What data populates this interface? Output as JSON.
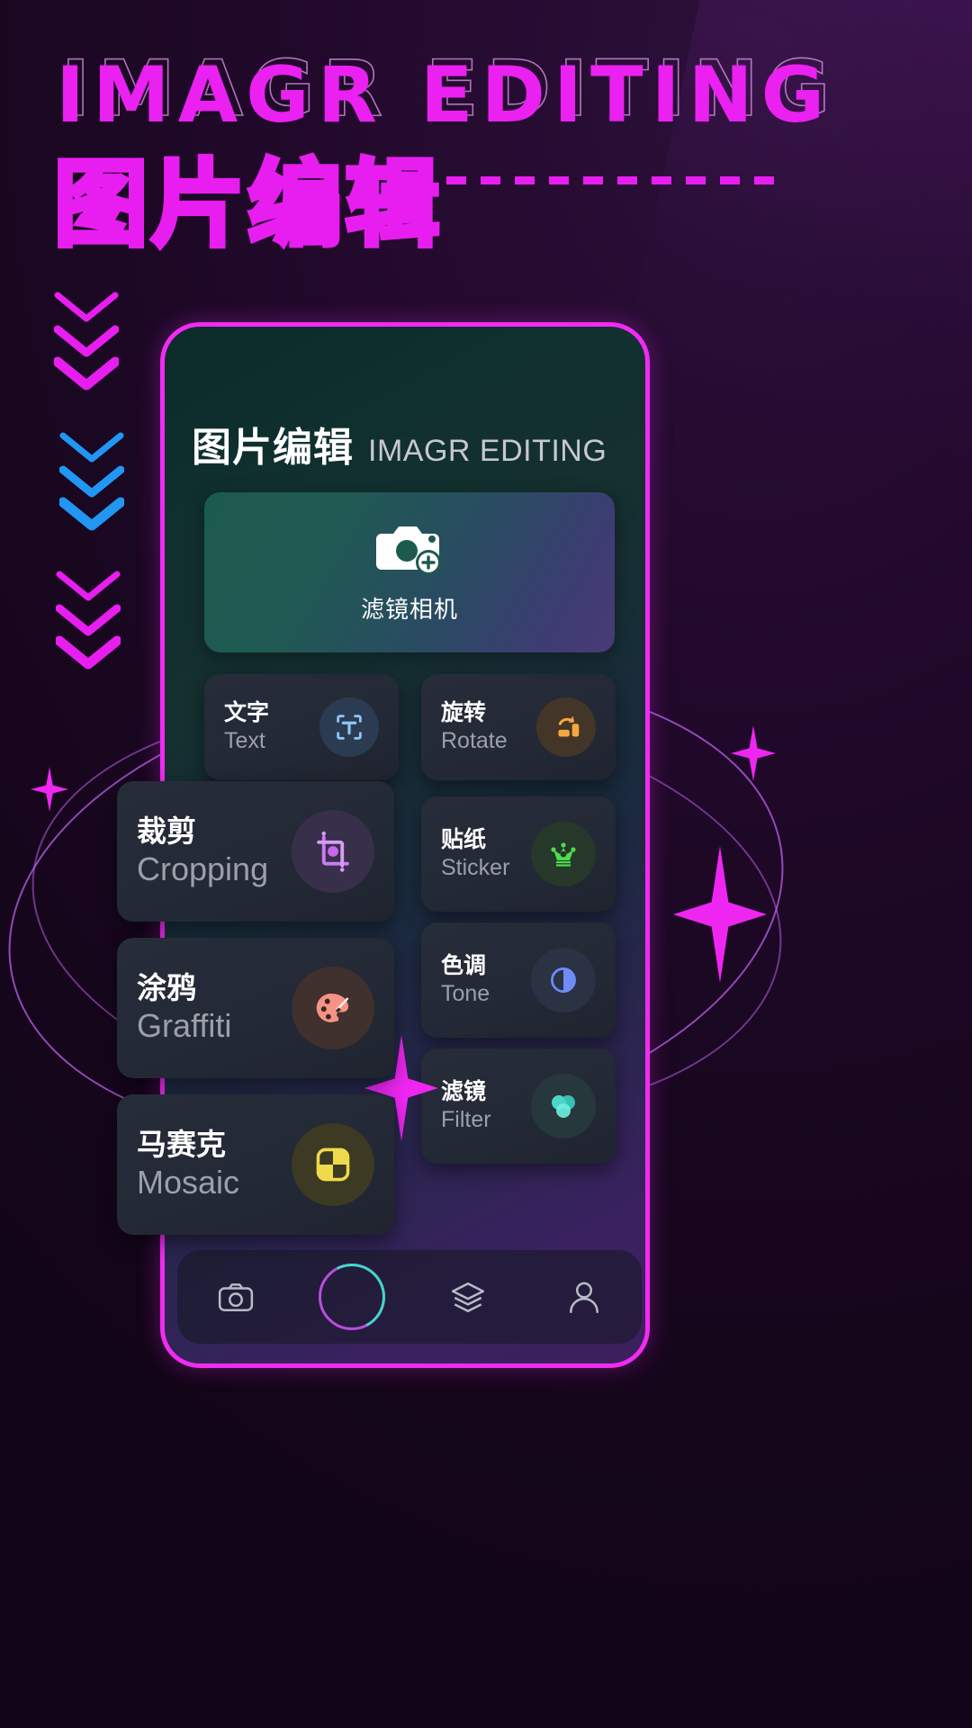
{
  "poster": {
    "title_en": "IMAGR EDITING",
    "title_cn": "图片编辑",
    "accent_color": "#e81ef0",
    "bg_color": "#1a0820"
  },
  "app": {
    "header": {
      "title_cn": "图片编辑",
      "title_en": "IMAGR EDITING"
    },
    "hero": {
      "label": "滤镜相机",
      "icon": "camera-plus-icon"
    },
    "features": [
      {
        "cn": "文字",
        "en": "Text",
        "icon": "text-frame-icon",
        "icon_color": "#8ec6f5",
        "icon_bg": "#2b3b52"
      },
      {
        "cn": "旋转",
        "en": "Rotate",
        "icon": "rotate-icon",
        "icon_color": "#f5a83c",
        "icon_bg": "#433527"
      },
      {
        "cn": "裁剪",
        "en": "Cropping",
        "icon": "crop-icon",
        "icon_color": "#c97ef0",
        "icon_bg": "#382f4a"
      },
      {
        "cn": "贴纸",
        "en": "Sticker",
        "icon": "crown-icon",
        "icon_color": "#4cdd4c",
        "icon_bg": "#26382a"
      },
      {
        "cn": "涂鸦",
        "en": "Graffiti",
        "icon": "palette-icon",
        "icon_color": "#f59384",
        "icon_bg": "#40302e"
      },
      {
        "cn": "色调",
        "en": "Tone",
        "icon": "contrast-icon",
        "icon_color": "#6e8cf7",
        "icon_bg": "#2a3244"
      },
      {
        "cn": "滤镜",
        "en": "Filter",
        "icon": "filter-circles-icon",
        "icon_color": "#4ee0cf",
        "icon_bg": "#27383c"
      },
      {
        "cn": "马赛克",
        "en": "Mosaic",
        "icon": "mosaic-icon",
        "icon_color": "#f0d94a",
        "icon_bg": "#3c3a22"
      }
    ],
    "navbar": [
      {
        "icon": "camera-icon",
        "label": ""
      },
      {
        "icon": "shutter-icon",
        "label": ""
      },
      {
        "icon": "layers-icon",
        "label": ""
      },
      {
        "icon": "profile-icon",
        "label": ""
      }
    ]
  }
}
